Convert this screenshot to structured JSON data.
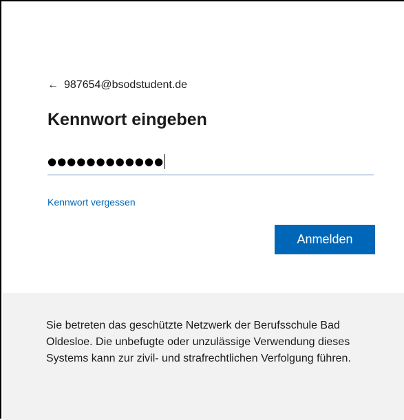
{
  "account": {
    "back_arrow": "←",
    "email": "987654@bsodstudent.de"
  },
  "title": "Kennwort eingeben",
  "password": {
    "masked_value": "●●●●●●●●●●●●"
  },
  "forgot_link": "Kennwort vergessen",
  "signin_button": "Anmelden",
  "footer": {
    "notice": "Sie betreten das geschützte Netzwerk der Berufsschule Bad Oldesloe. Die unbefugte oder unzulässige Verwendung dieses Systems kann zur zivil- und strafrechtlichen Verfolgung führen."
  },
  "colors": {
    "accent": "#0067b8",
    "footer_bg": "#f2f2f2",
    "text": "#1b1b1b"
  }
}
